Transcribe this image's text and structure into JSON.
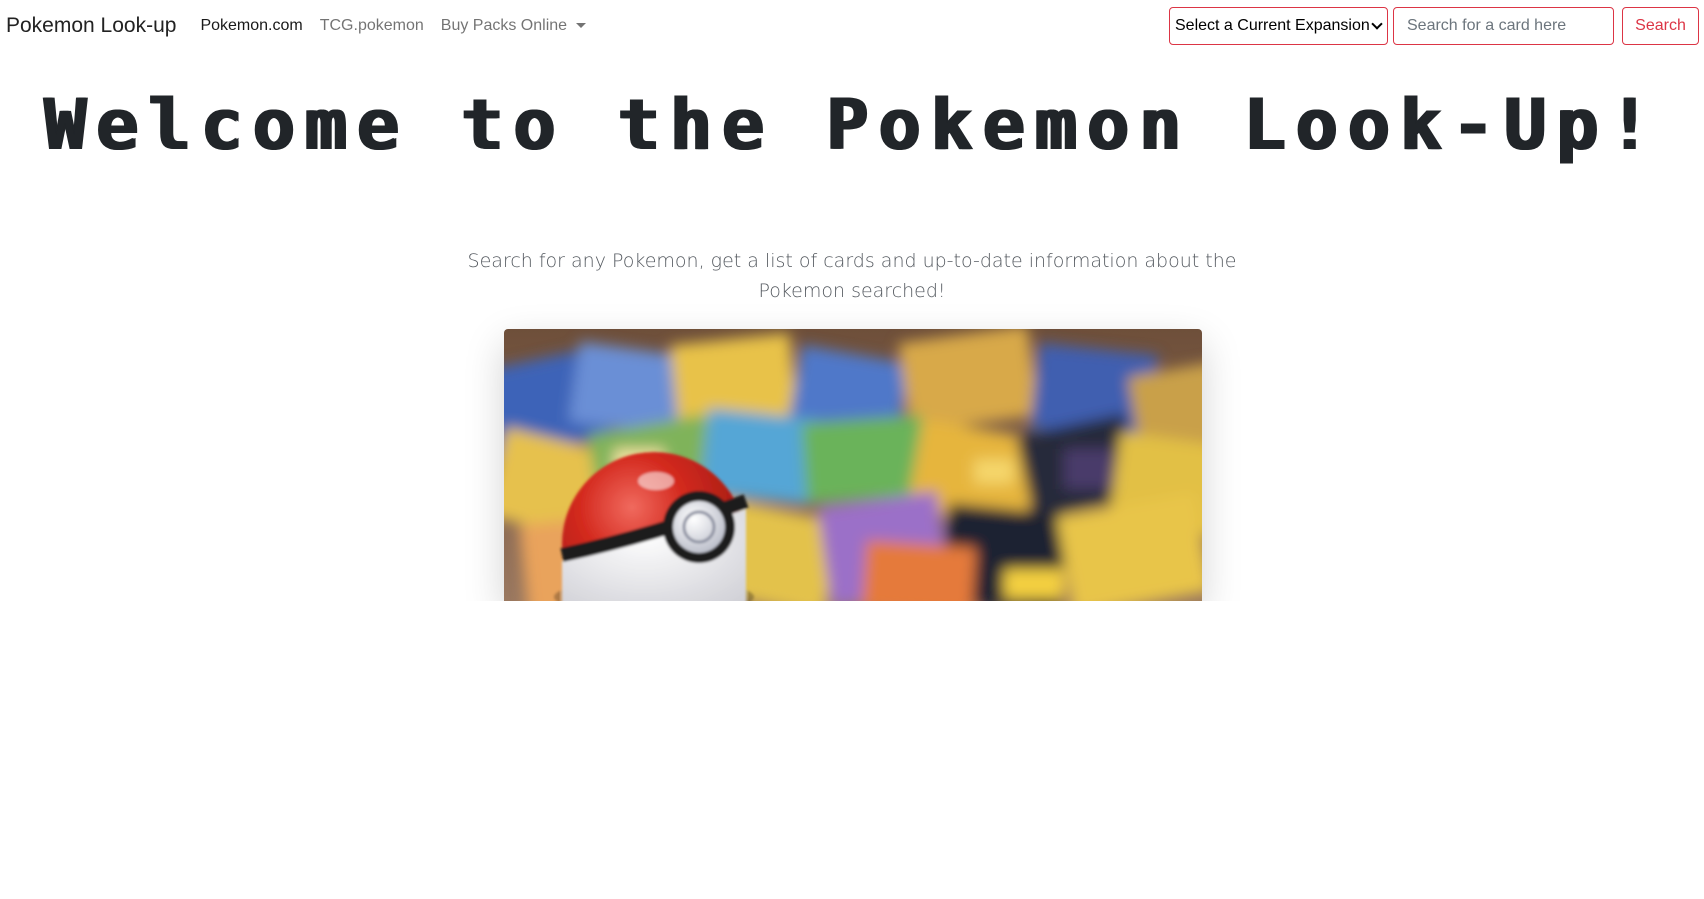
{
  "navbar": {
    "brand": "Pokemon Look-up",
    "links": [
      {
        "label": "Pokemon.com",
        "active": true
      },
      {
        "label": "TCG.pokemon",
        "active": false
      },
      {
        "label": "Buy Packs Online",
        "dropdown": true
      }
    ],
    "expansion_select": {
      "selected": "Select a Current Expansion"
    },
    "search": {
      "placeholder": "Search for a card here",
      "value": ""
    },
    "search_button": "Search"
  },
  "hero": {
    "title": "Welcome to the Pokemon Look-Up!",
    "lead": "Search for any Pokemon, get a list of cards and up-to-date information about the Pokemon searched!"
  },
  "image": {
    "subject": "pokeball-on-trading-cards",
    "colors": {
      "accent": "#dc3545",
      "pokeball_red": "#d1261d",
      "pokeball_white": "#f2f2f4"
    }
  }
}
